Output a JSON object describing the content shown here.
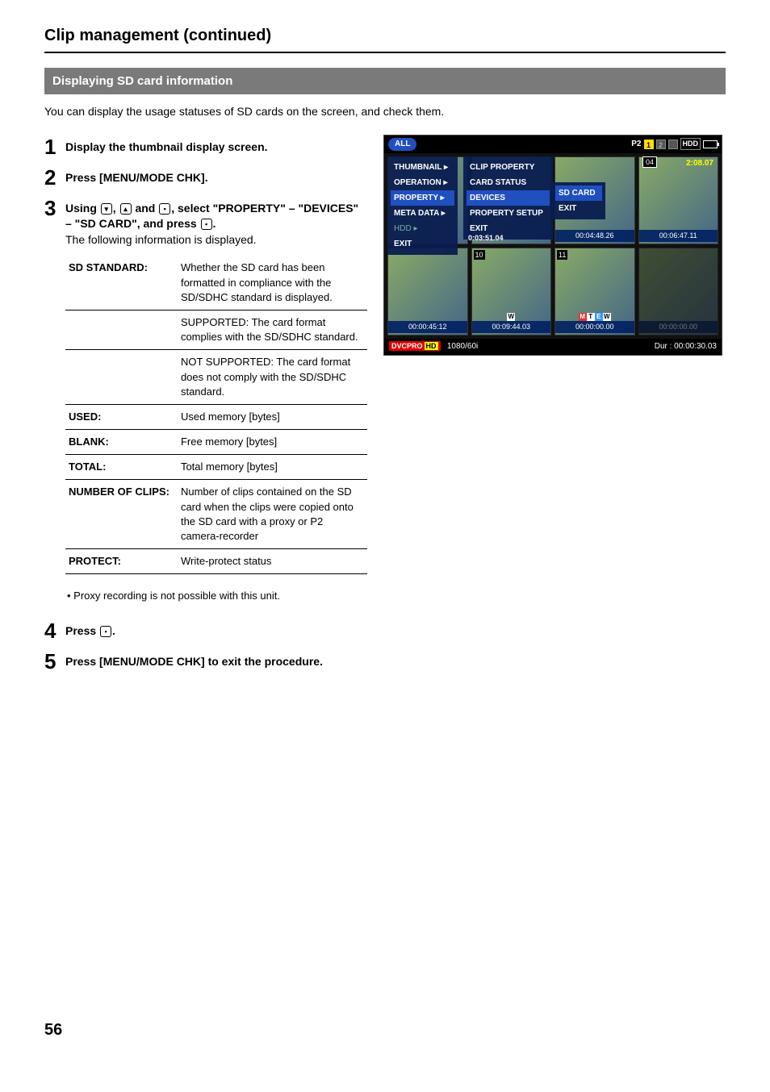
{
  "page": {
    "title": "Clip management (continued)",
    "section_bar": "Displaying SD card information",
    "intro": "You can display the usage statuses of SD cards on the screen, and check them.",
    "page_number": "56"
  },
  "steps": {
    "s1": {
      "num": "1",
      "text": "Display the thumbnail display screen."
    },
    "s2": {
      "num": "2",
      "text": "Press [MENU/MODE CHK]."
    },
    "s3": {
      "num": "3",
      "line1a": "Using ",
      "line1b": ", ",
      "line1c": " and ",
      "line1d": ", select \"PROPERTY\" – \"DEVICES\" – \"SD CARD\", and press ",
      "line1e": ".",
      "line2": "The following information is displayed."
    },
    "s4": {
      "num": "4",
      "text_a": "Press ",
      "text_b": "."
    },
    "s5": {
      "num": "5",
      "text": "Press [MENU/MODE CHK] to exit the procedure."
    }
  },
  "note": "Proxy recording is not possible with this unit.",
  "table": {
    "r1": {
      "label": "SD STANDARD:",
      "val": "Whether the SD card has been formatted in compliance with the SD/SDHC standard is displayed."
    },
    "r1b": {
      "val": "SUPPORTED: The card format complies with the SD/SDHC standard."
    },
    "r1c": {
      "val": "NOT SUPPORTED: The card format does not comply with the SD/SDHC standard."
    },
    "r2": {
      "label": "USED:",
      "val": "Used memory [bytes]"
    },
    "r3": {
      "label": "BLANK:",
      "val": "Free memory [bytes]"
    },
    "r4": {
      "label": "TOTAL:",
      "val": "Total memory [bytes]"
    },
    "r5": {
      "label": "NUMBER OF CLIPS:",
      "val": "Number of clips contained on the SD card when the clips were copied onto the SD card with a proxy or P2 camera-recorder"
    },
    "r6": {
      "label": "PROTECT:",
      "val": "Write-protect status"
    }
  },
  "osd": {
    "top_pill": "ALL",
    "p2_label": "P2",
    "slot1": "1",
    "slot2": "2",
    "hdd_label": "HDD",
    "clip_num": "04",
    "tc_top": "2:08.07",
    "menu": {
      "thumbnail": "THUMBNAIL",
      "operation": "OPERATION",
      "property": "PROPERTY",
      "metadata": "META DATA",
      "hdd": "HDD",
      "exit": "EXIT"
    },
    "submenu": {
      "clip_property": "CLIP PROPERTY",
      "card_status": "CARD STATUS",
      "devices": "DEVICES",
      "property_setup": "PROPERTY SETUP",
      "exit": "EXIT"
    },
    "submenu2": {
      "sd_card": "SD CARD",
      "exit": "EXIT"
    },
    "thumbs": {
      "t1": {
        "idx": "",
        "tc": ""
      },
      "t2": {
        "idx": "",
        "tc": ""
      },
      "t3": {
        "idx": "",
        "tc": "00:04:48.26"
      },
      "t4": {
        "idx": "",
        "tc": "00:06:47.11"
      },
      "t5": {
        "idx": "",
        "tc": "00:00:45:12"
      },
      "t6": {
        "idx": "10",
        "tc": "00:09:44.03"
      },
      "t7": {
        "idx": "11",
        "tc": "00:00:00.00"
      },
      "t8": {
        "idx": "",
        "tc": "00:00:00.00"
      },
      "t_mid": "0:03:51.04"
    },
    "bottom": {
      "format_logo": "DVCPRO",
      "format_hd": "HD",
      "format_mode": "1080/60i",
      "duration_label": "Dur : 00:00:30.03"
    }
  }
}
